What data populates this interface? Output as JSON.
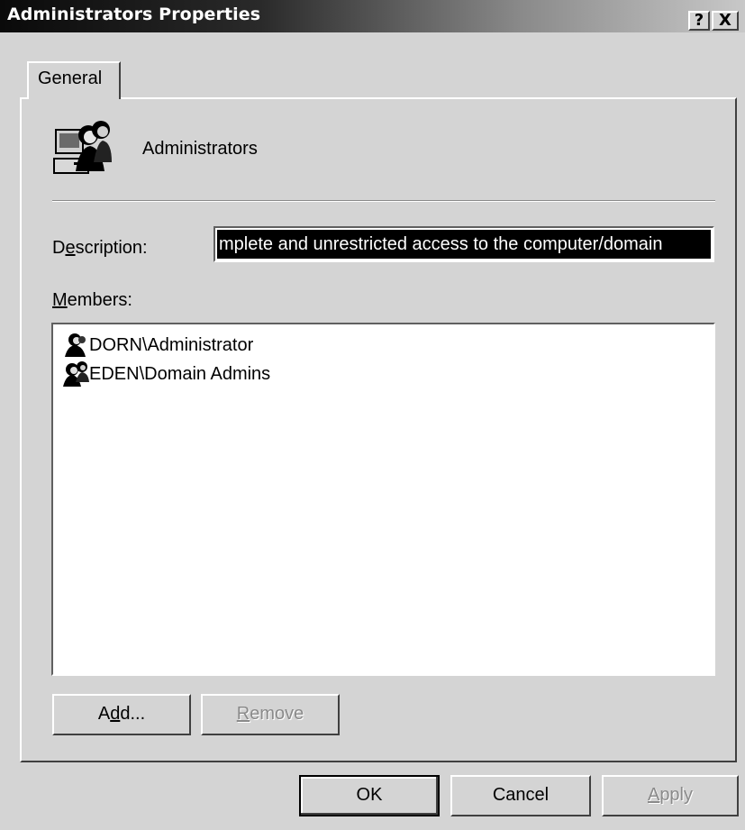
{
  "window": {
    "title": "Administrators Properties",
    "help_button": "?",
    "close_button": "X"
  },
  "tabs": [
    {
      "label": "General",
      "selected": true
    }
  ],
  "group": {
    "icon": "group-icon",
    "name": "Administrators"
  },
  "description": {
    "label_prefix": "D",
    "label_accel": "e",
    "label_suffix": "scription:",
    "value": "mplete and unrestricted access to the computer/domain"
  },
  "members": {
    "label_accel": "M",
    "label_suffix": "embers:",
    "items": [
      {
        "icon": "user-icon",
        "name": "DORN\\Administrator"
      },
      {
        "icon": "group-icon",
        "name": "EDEN\\Domain Admins"
      }
    ]
  },
  "buttons": {
    "add_prefix": "A",
    "add_accel": "d",
    "add_suffix": "d...",
    "remove_accel": "R",
    "remove_suffix": "emove",
    "ok": "OK",
    "cancel": "Cancel",
    "apply_accel": "A",
    "apply_suffix": "pply"
  }
}
